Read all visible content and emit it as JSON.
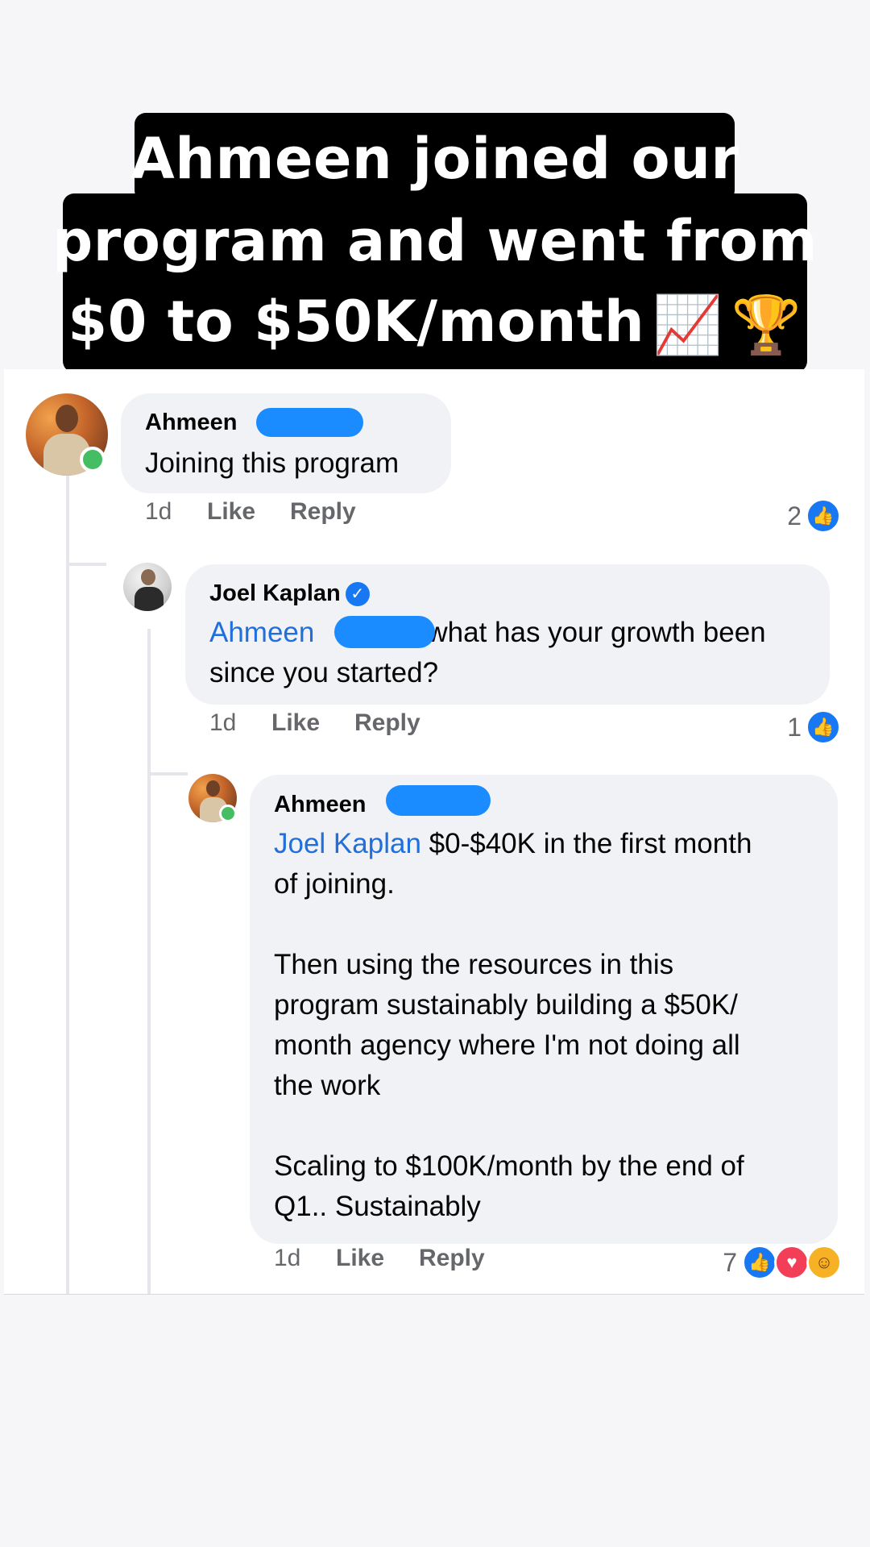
{
  "caption": {
    "line1": "Ahmeen joined our",
    "line2": "program and went from",
    "line3": "$0 to $50K/month",
    "emoji_chart": "📈",
    "emoji_trophy": "🏆"
  },
  "comments": [
    {
      "author": "Ahmeen",
      "text": "Joining this program",
      "time": "1d",
      "like_label": "Like",
      "reply_label": "Reply",
      "reaction_count": "2",
      "reactions": [
        "like-icon"
      ],
      "online": true
    },
    {
      "author": "Joel Kaplan",
      "verified": true,
      "mention": "Ahmeen",
      "text_line1": "what has your growth been",
      "text_line2": "since you started?",
      "time": "1d",
      "like_label": "Like",
      "reply_label": "Reply",
      "reaction_count": "1",
      "reactions": [
        "like-icon"
      ]
    },
    {
      "author": "Ahmeen",
      "mention": "Joel Kaplan",
      "text_line1": "$0-$40K in the first month",
      "text_line2": "of joining.",
      "text_line3": "Then using the resources in this",
      "text_line4": "program sustainably building a $50K/",
      "text_line5": "month agency where I'm not doing all",
      "text_line6": "the work",
      "text_line7": "Scaling to $100K/month by the end of",
      "text_line8": "Q1.. Sustainably",
      "time": "1d",
      "like_label": "Like",
      "reply_label": "Reply",
      "reaction_count": "7",
      "reactions": [
        "like-icon",
        "love-icon",
        "care-icon"
      ],
      "online": true
    }
  ],
  "colors": {
    "mention": "#216fdb",
    "like": "#1877f2",
    "love": "#f33e58",
    "online": "#45bd62"
  }
}
